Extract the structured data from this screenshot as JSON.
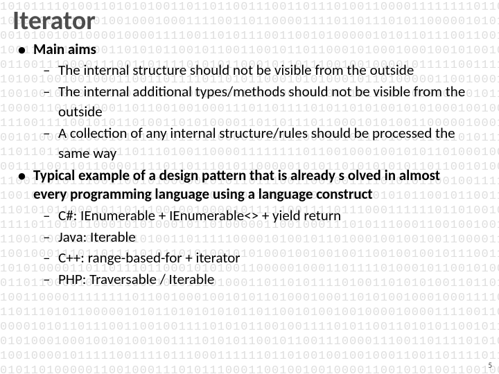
{
  "title": "Iterator",
  "bullets": [
    {
      "label": "Main aims",
      "children": [
        "The internal structure should not be visible from the outside",
        "The internal additional types/methods should not be visible from the outside",
        "A collection of any internal structure/rules should be processed the same way"
      ]
    },
    {
      "label": "Typical example of a design pattern that is already s  olved in almost every programming language using a language construct",
      "children": [
        "C#: IEnumerable + IEnumerable<> + yield return",
        "Java: Iterable",
        "C++: range-based-for + iterator",
        "PHP: Traversable / Iterable"
      ]
    }
  ],
  "page_number": "5",
  "background_bits": "1010111101001101010100110110110011100110111010011000011111111011001000100101011010001000110101001000100011110011011000011110110111010110000010101101010101011011001010010010000100001111001101011100110010100000101011011100110010011110101011001001111010110011010101100101100110010110110001010001000100101001001111010101100101100111000011100110111101010110001011011100100100001011111001111011100011111101101001001001000110011011110110101100010101000101101000001100100011101011100011001001001000011001010100110010000110110011010011011111000010100101101000100100100110000110101100011011001001000111011011110101101010010101000100100100110010010010111001111001010110100110101000011011011101100010101001100000100011011110100010110010100001100010111101011011000010111110001010111010001101"
}
